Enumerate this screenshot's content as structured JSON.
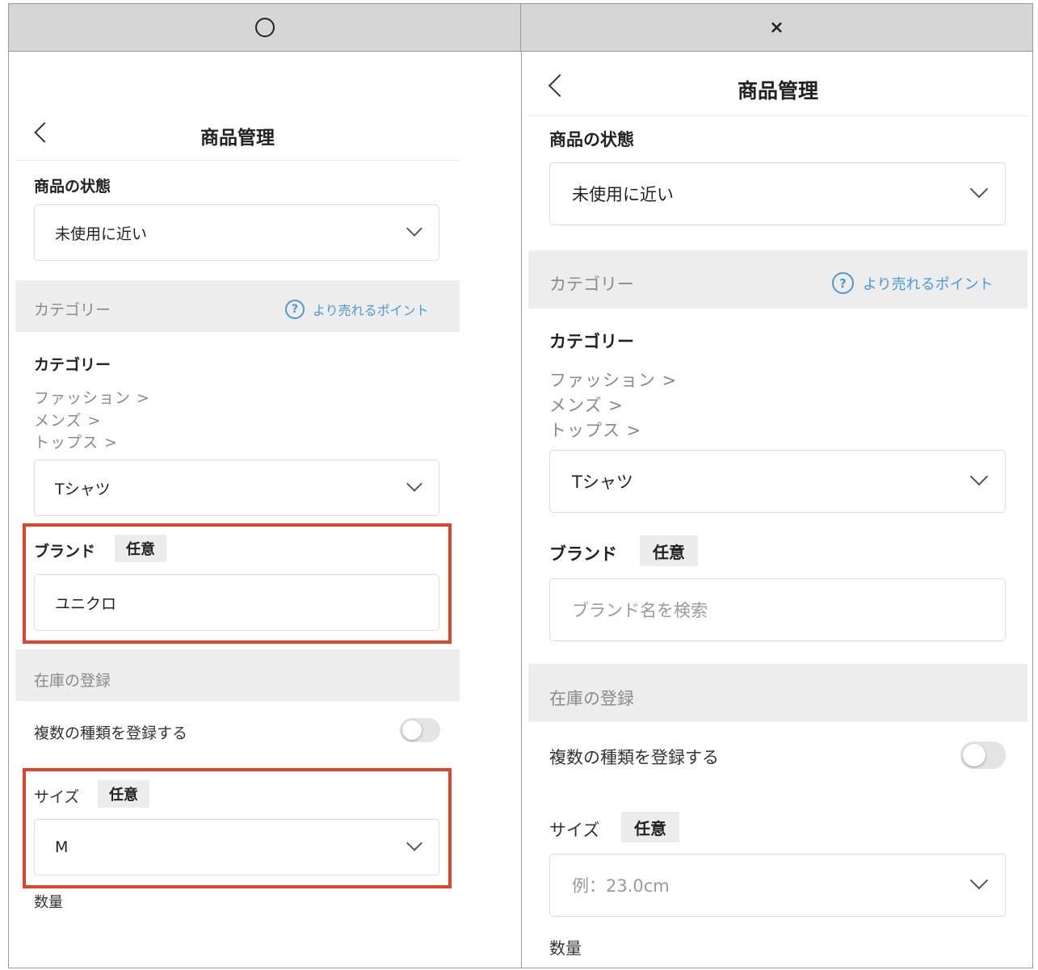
{
  "columns": {
    "left": {
      "mark": "○"
    },
    "right": {
      "mark": "×"
    }
  },
  "left": {
    "nav_title": "商品管理",
    "condition_label": "商品の状態",
    "condition_value": "未使用に近い",
    "category_band": "カテゴリー",
    "help_link": "より売れるポイント",
    "category_label": "カテゴリー",
    "category_path": [
      "ファッション >",
      "メンズ >",
      "トップス >"
    ],
    "category_value": "Tシャツ",
    "brand_label": "ブランド",
    "optional_badge": "任意",
    "brand_value": "ユニクロ",
    "inventory_band": "在庫の登録",
    "multi_variant_label": "複数の種類を登録する",
    "multi_variant_on": false,
    "size_label": "サイズ",
    "size_badge": "任意",
    "size_value": "M",
    "quantity_label": "数量"
  },
  "right": {
    "nav_title": "商品管理",
    "condition_label": "商品の状態",
    "condition_value": "未使用に近い",
    "category_band": "カテゴリー",
    "help_link": "より売れるポイント",
    "category_label": "カテゴリー",
    "category_path": [
      "ファッション >",
      "メンズ >",
      "トップス >"
    ],
    "category_value": "Tシャツ",
    "brand_label": "ブランド",
    "optional_badge": "任意",
    "brand_placeholder": "ブランド名を検索",
    "inventory_band": "在庫の登録",
    "multi_variant_label": "複数の種類を登録する",
    "multi_variant_on": false,
    "size_label": "サイズ",
    "size_badge": "任意",
    "size_placeholder": "例：23.0cm",
    "quantity_label": "数量"
  },
  "colors": {
    "highlight": "#e0452b",
    "link": "#4a9ad8",
    "band": "#ededed"
  },
  "icons": [
    "back-chevron-icon",
    "dropdown-chevron-icon",
    "help-circle-icon",
    "toggle-switch"
  ]
}
